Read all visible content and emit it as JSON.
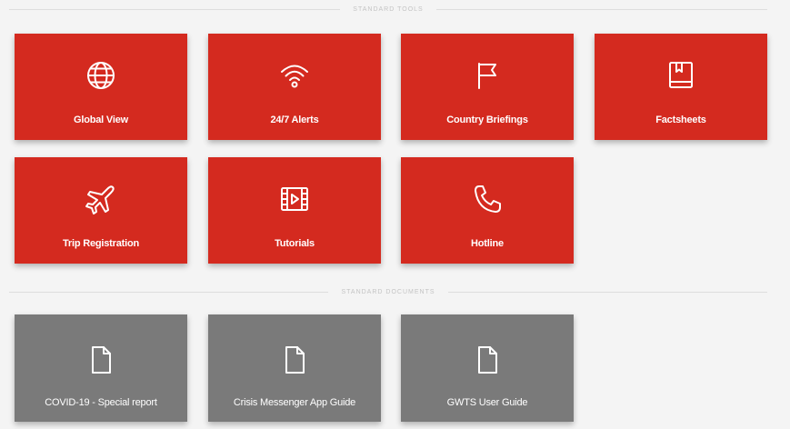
{
  "sections": {
    "tools_header": "Standard Tools",
    "documents_header": "Standard Documents"
  },
  "tools": [
    {
      "label": "Global View",
      "icon": "globe-icon"
    },
    {
      "label": "24/7 Alerts",
      "icon": "wifi-icon"
    },
    {
      "label": "Country Briefings",
      "icon": "flag-icon"
    },
    {
      "label": "Factsheets",
      "icon": "book-icon"
    },
    {
      "label": "Trip Registration",
      "icon": "airplane-icon"
    },
    {
      "label": "Tutorials",
      "icon": "video-icon"
    },
    {
      "label": "Hotline",
      "icon": "phone-icon"
    }
  ],
  "documents": [
    {
      "label": "COVID-19 - Special report",
      "icon": "document-icon"
    },
    {
      "label": "Crisis Messenger App Guide",
      "icon": "document-icon"
    },
    {
      "label": "GWTS User Guide",
      "icon": "document-icon"
    }
  ],
  "colors": {
    "tool_tile": "#d42a1f",
    "document_tile": "#7a7a7a",
    "background": "#f4f4f4"
  }
}
